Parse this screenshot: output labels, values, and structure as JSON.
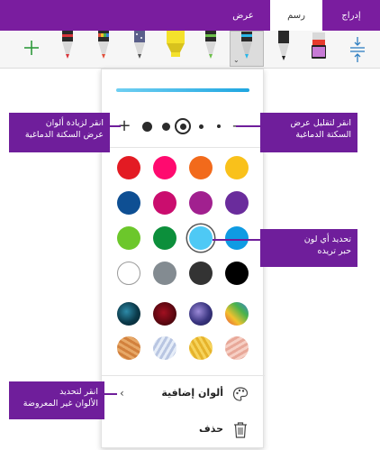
{
  "ribbon": {
    "tabs": [
      {
        "label": "إدراج"
      },
      {
        "label": "رسم"
      },
      {
        "label": "عرض"
      }
    ],
    "active_tab": "رسم"
  },
  "toolbar": {
    "tools": [
      {
        "name": "height-adjust-icon",
        "color": "#2f7fc1"
      },
      {
        "name": "highlighter-purple",
        "color": "#c77ad6"
      },
      {
        "name": "pen-black",
        "color": "#222222"
      },
      {
        "name": "pen-light-blue",
        "color": "#29b6e8"
      },
      {
        "name": "pen-green",
        "color": "#6cc04a"
      },
      {
        "name": "highlighter-yellow",
        "color": "#f4e12b"
      },
      {
        "name": "pencil-galaxy",
        "color": "#5a5f8a"
      },
      {
        "name": "pen-rainbow",
        "color": "#e2503b"
      },
      {
        "name": "pen-red",
        "color": "#d9343a"
      },
      {
        "name": "pen-dark",
        "color": "#2a2a2a"
      },
      {
        "name": "add-pen-icon",
        "color": "#2e9a3c"
      }
    ]
  },
  "panel": {
    "stroke_preview_color": "#29b6e8",
    "colors": [
      [
        "#f9c11b",
        "#f26a1b",
        "#ff0a6f",
        "#e31b23"
      ],
      [
        "#6a2c9c",
        "#a1208f",
        "#ca0d6e",
        "#0e4f93"
      ],
      [
        "#0f9be3",
        "#4ec9f5",
        "#0c8f3b",
        "#6cc72b"
      ],
      [
        "#000000",
        "#333333",
        "#838b91",
        "#ffffff"
      ]
    ],
    "selected_color": "#4ec9f5",
    "more_colors_label": "ألوان إضافية",
    "delete_label": "حذف"
  },
  "callouts": {
    "decrease_width": [
      "انقر لتقليل عرض",
      "السكتة الدماغية"
    ],
    "increase_width": [
      "انقر لزيادة ألوان",
      "عرض السكتة الدماغية"
    ],
    "pick_color": [
      "تحديد أي لون",
      "حبر تريده"
    ],
    "more_colors": [
      "انقر لتحديد",
      "الألوان غير المعروضة"
    ]
  }
}
